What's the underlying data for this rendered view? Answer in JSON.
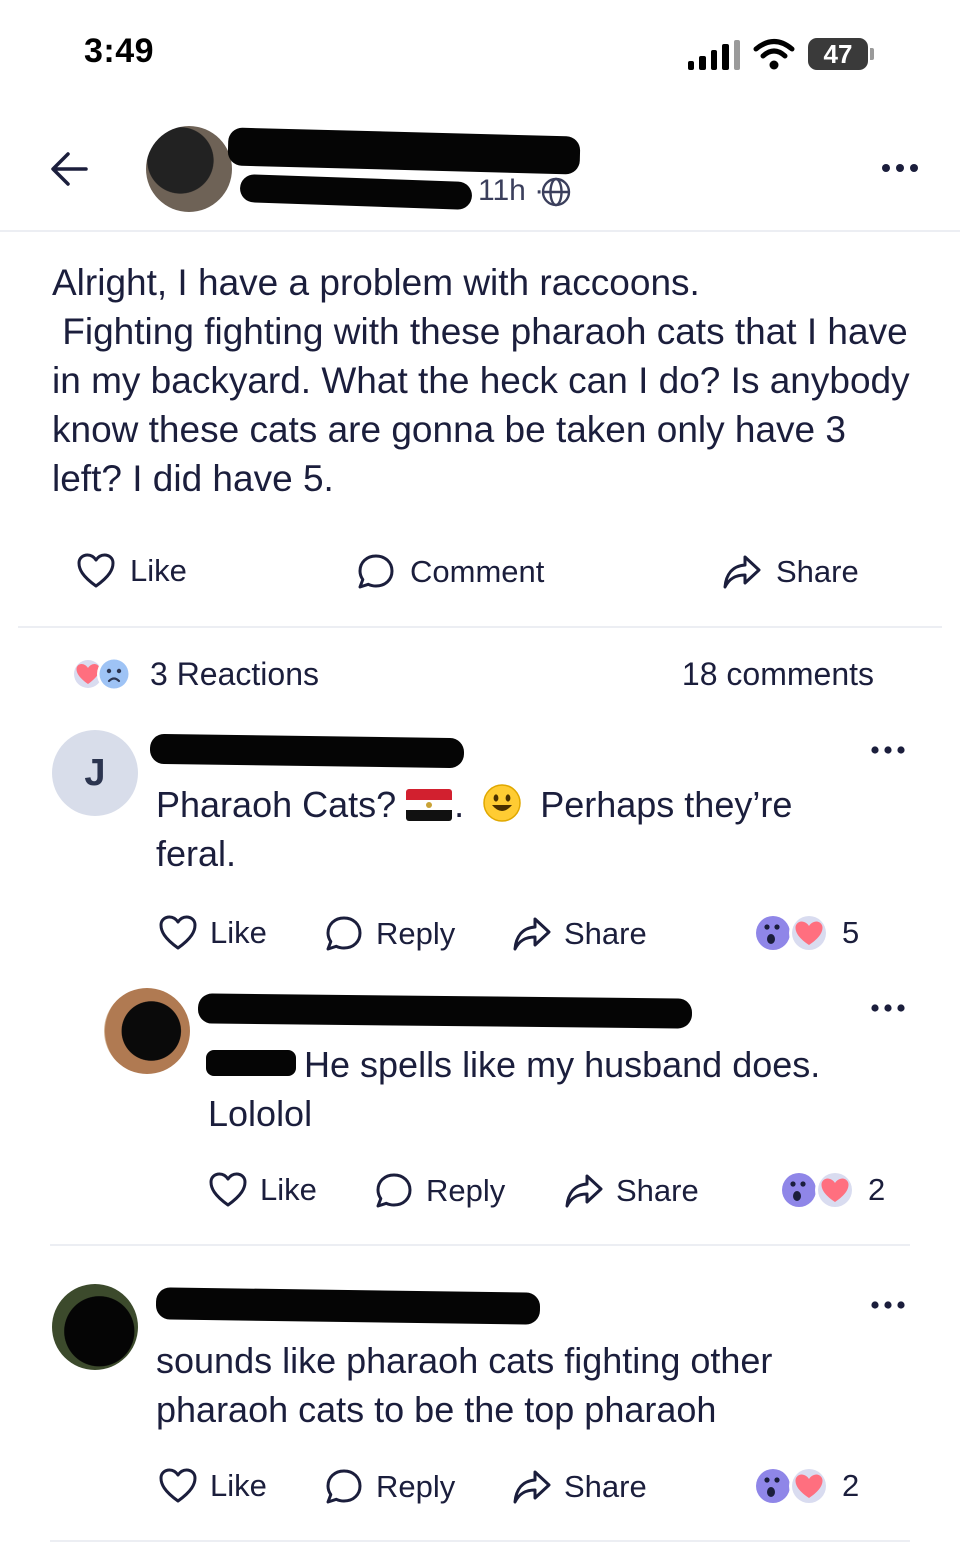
{
  "status_bar": {
    "time": "3:49",
    "battery": "47"
  },
  "post": {
    "meta_time": "11h ·",
    "body": "Alright, I have a problem with raccoons.\n Fighting fighting with these pharaoh cats that I have in my backyard. What the heck can I do? Is anybody know these cats are gonna be taken only have 3 left? I did have 5.",
    "actions": {
      "like": "Like",
      "comment": "Comment",
      "share": "Share"
    },
    "reactions_label": "3 Reactions",
    "comments_label": "18 comments"
  },
  "comments": [
    {
      "avatar_initial": "J",
      "text_before": "Pharaoh Cats?",
      "text_mid": ".",
      "text_after": "Perhaps they’re feral.",
      "like": "Like",
      "reply": "Reply",
      "share": "Share",
      "reaction_count": "5"
    },
    {
      "text": "He spells like my husband does. Lololol",
      "like": "Like",
      "reply": "Reply",
      "share": "Share",
      "reaction_count": "2"
    },
    {
      "text": "sounds like pharaoh cats fighting other pharaoh cats to be the top pharaoh",
      "like": "Like",
      "reply": "Reply",
      "share": "Share",
      "reaction_count": "2"
    }
  ],
  "icons": {
    "back": "back-arrow-icon",
    "more": "more-dots-icon",
    "globe": "globe-icon",
    "like": "heart-outline-icon",
    "comment": "speech-bubble-icon",
    "share": "share-arrow-icon"
  },
  "colors": {
    "text": "#1b1e3c",
    "divider": "#eceef3",
    "heart": "#ff6f7f",
    "surprised": "#8f86e8",
    "sad": "#8fb6f2"
  }
}
